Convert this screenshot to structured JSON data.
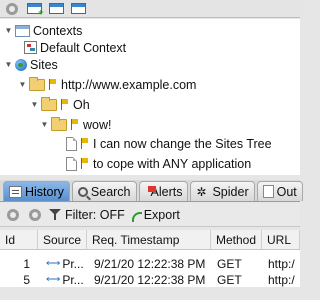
{
  "toolbar": {
    "buttons": [
      {
        "icon": "circle-icon"
      },
      {
        "icon": "new-window-icon"
      },
      {
        "icon": "window-icon"
      },
      {
        "icon": "window-split-icon"
      }
    ]
  },
  "tree": {
    "nodes": [
      {
        "label": "Contexts",
        "icon": "contexts-icon",
        "expanded": true
      },
      {
        "label": "Default Context",
        "icon": "context-icon"
      },
      {
        "label": "Sites",
        "icon": "globe-icon",
        "expanded": true
      },
      {
        "label": "http://www.example.com",
        "icon": "folder-icon",
        "flag": true,
        "expanded": true
      },
      {
        "label": "Oh",
        "icon": "folder-icon",
        "flag": true,
        "expanded": true
      },
      {
        "label": "wow!",
        "icon": "folder-icon",
        "flag": true,
        "expanded": true
      },
      {
        "label": "I can now change the Sites Tree",
        "icon": "file-icon",
        "flag": true
      },
      {
        "label": "to cope with ANY application",
        "icon": "file-icon",
        "flag": true
      }
    ]
  },
  "tabs": [
    {
      "label": "History",
      "icon": "history-icon",
      "active": true
    },
    {
      "label": "Search",
      "icon": "search-icon",
      "active": false
    },
    {
      "label": "Alerts",
      "icon": "alerts-flag-icon",
      "active": false
    },
    {
      "label": "Spider",
      "icon": "spider-icon",
      "active": false
    },
    {
      "label": "Out",
      "icon": "output-icon",
      "active": false
    }
  ],
  "history_toolbar": {
    "filter_label": "Filter: OFF",
    "export_label": "Export"
  },
  "table": {
    "columns": [
      "Id",
      "Source",
      "Req. Timestamp",
      "Method",
      "URL"
    ],
    "rows": [
      {
        "id": "1",
        "source": "Pr...",
        "timestamp": "9/21/20 12:22:38 PM",
        "method": "GET",
        "url": "http:/"
      },
      {
        "id": "5",
        "source": "Pr...",
        "timestamp": "9/21/20 12:22:38 PM",
        "method": "GET",
        "url": "http:/"
      }
    ]
  },
  "colors": {
    "active_tab": "#6f9fd8",
    "folder": "#f2cf72",
    "flag": "#e8b800"
  }
}
